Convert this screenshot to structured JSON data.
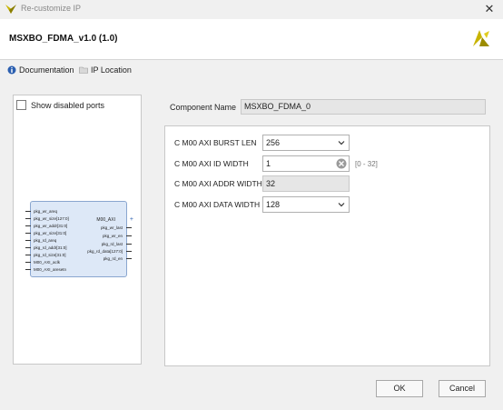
{
  "window": {
    "title": "Re-customize IP",
    "close_label": "✕"
  },
  "header": {
    "ip_name": "MSXBO_FDMA_v1.0 (1.0)"
  },
  "links": {
    "documentation": "Documentation",
    "ip_location": "IP Location"
  },
  "left_panel": {
    "show_disabled_ports_label": "Show disabled ports",
    "symbol": {
      "left_ports": [
        "pkg_wr_areq",
        "pkg_wr_size[127:0]",
        "pkg_wr_addr[31:0]",
        "pkg_wr_size[31:0]",
        "pkg_rd_areq",
        "pkg_rd_addr[31:0]",
        "pkg_rd_size[31:0]",
        "M00_AXI_aclk",
        "M00_AXI_aresetn"
      ],
      "right_ports": [
        "M00_AXI",
        "pkg_wr_last",
        "pkg_wr_en",
        "pkg_rd_last",
        "pkg_rd_data[127:0]",
        "pkg_rd_en"
      ]
    }
  },
  "component": {
    "label": "Component Name",
    "value": "MSXBO_FDMA_0"
  },
  "params": {
    "burst_len": {
      "label": "C M00 AXI BURST LEN",
      "value": "256"
    },
    "id_width": {
      "label": "C M00 AXI ID WIDTH",
      "value": "1",
      "range": "[0 - 32]"
    },
    "addr_width": {
      "label": "C M00 AXI ADDR WIDTH",
      "value": "32"
    },
    "data_width": {
      "label": "C M00 AXI DATA WIDTH",
      "value": "128"
    }
  },
  "buttons": {
    "ok": "OK",
    "cancel": "Cancel"
  },
  "colors": {
    "accent": "#2b5fb0",
    "logo": "#c8b400",
    "symbol_fill": "#dde8f7"
  }
}
